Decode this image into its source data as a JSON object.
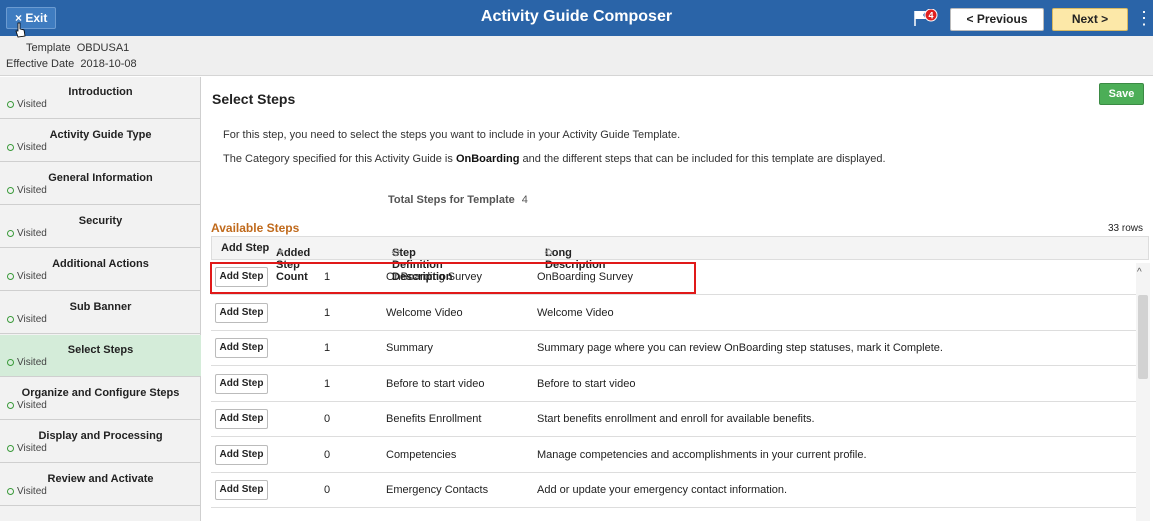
{
  "topbar": {
    "exit_label": "× Exit",
    "title": "Activity Guide Composer",
    "notification_count": "4",
    "prev_label": "< Previous",
    "next_label": "Next >",
    "menu_icon": "⋮"
  },
  "header": {
    "template_label": "Template",
    "template_value": "OBDUSA1",
    "effective_date_label": "Effective Date",
    "effective_date_value": "2018-10-08"
  },
  "sidebar": {
    "items": [
      {
        "label": "Introduction",
        "status": "Visited"
      },
      {
        "label": "Activity Guide Type",
        "status": "Visited"
      },
      {
        "label": "General Information",
        "status": "Visited"
      },
      {
        "label": "Security",
        "status": "Visited"
      },
      {
        "label": "Additional Actions",
        "status": "Visited"
      },
      {
        "label": "Sub Banner",
        "status": "Visited"
      },
      {
        "label": "Select Steps",
        "status": "Visited"
      },
      {
        "label": "Organize and Configure Steps",
        "status": "Visited"
      },
      {
        "label": "Display and Processing",
        "status": "Visited"
      },
      {
        "label": "Review and Activate",
        "status": "Visited"
      }
    ],
    "active_index": 6
  },
  "main": {
    "title": "Select Steps",
    "save_label": "Save",
    "para1": "For this step, you need to select the steps you want to include in your Activity Guide Template.",
    "para2_pre": "The Category specified for this Activity Guide is ",
    "para2_bold": "OnBoarding",
    "para2_post": " and the different steps that can be included for this template are displayed.",
    "total_label": "Total Steps for Template",
    "total_value": "4",
    "available_label": "Available Steps",
    "rows_count": "33 rows",
    "columns": {
      "add_step": "Add Step",
      "added_count": "Added Step Count",
      "step_def": "Step Definition Description",
      "long_desc": "Long Description"
    },
    "rows": [
      {
        "add": "Add Step",
        "count": "1",
        "step_def": "OnBoarding Survey",
        "long_desc": "OnBoarding Survey"
      },
      {
        "add": "Add Step",
        "count": "1",
        "step_def": "Welcome Video",
        "long_desc": "Welcome Video"
      },
      {
        "add": "Add Step",
        "count": "1",
        "step_def": "Summary",
        "long_desc": "Summary page where you can review OnBoarding step statuses, mark it Complete."
      },
      {
        "add": "Add Step",
        "count": "1",
        "step_def": "Before to start video",
        "long_desc": "Before to start video"
      },
      {
        "add": "Add Step",
        "count": "0",
        "step_def": "Benefits Enrollment",
        "long_desc": "Start benefits enrollment and enroll for available benefits."
      },
      {
        "add": "Add Step",
        "count": "0",
        "step_def": "Competencies",
        "long_desc": "Manage competencies and accomplishments in your current profile."
      },
      {
        "add": "Add Step",
        "count": "0",
        "step_def": "Emergency Contacts",
        "long_desc": "Add or update your emergency contact information."
      }
    ]
  },
  "colors": {
    "topbar": "#2a64a8",
    "save": "#4cae57",
    "available": "#c06a1c",
    "highlight": "#e01919"
  }
}
